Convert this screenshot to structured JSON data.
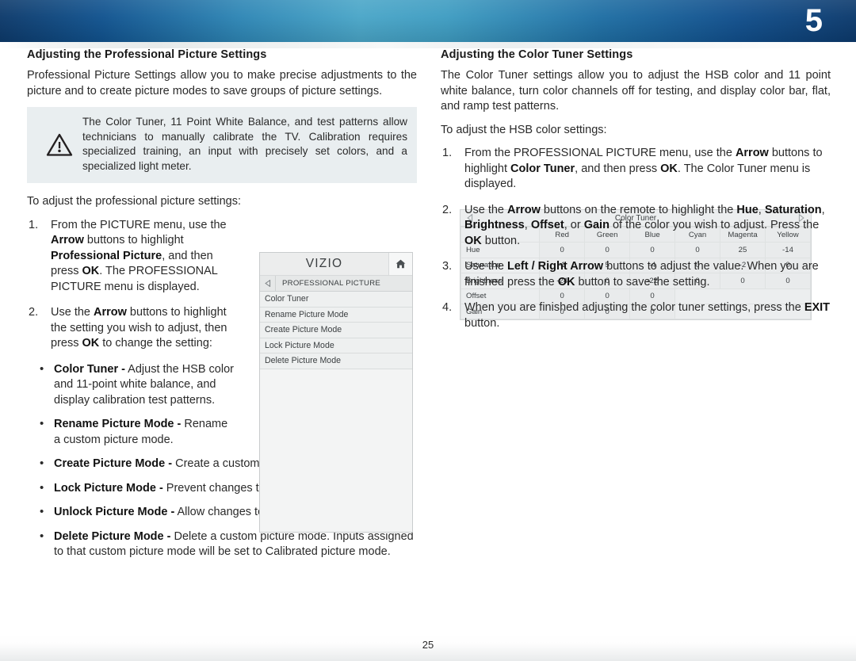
{
  "banner": {
    "chapter_number": "5"
  },
  "left_column": {
    "title": "Adjusting the Professional Picture Settings",
    "intro": "Professional Picture Settings allow you to make precise adjustments to the picture and to create picture modes to save groups of picture settings.",
    "note": {
      "icon": "warning-triangle-icon",
      "text": "The Color Tuner, 11 Point White Balance, and test patterns allow technicians to manually calibrate the TV. Calibration requires specialized training, an input with precisely set colors, and a specialized light meter."
    },
    "lead_in": "To adjust the professional picture settings:",
    "steps": [
      {
        "num": "1.",
        "parts": [
          {
            "t": "From the PICTURE menu, use the ",
            "b": false
          },
          {
            "t": "Arrow",
            "b": true
          },
          {
            "t": " buttons to highlight ",
            "b": false
          },
          {
            "t": "Professional Picture",
            "b": true
          },
          {
            "t": ", and then press ",
            "b": false
          },
          {
            "t": "OK",
            "b": true
          },
          {
            "t": ". The PROFESSIONAL PICTURE menu is displayed.",
            "b": false
          }
        ]
      },
      {
        "num": "2.",
        "parts": [
          {
            "t": "Use the ",
            "b": false
          },
          {
            "t": "Arrow",
            "b": true
          },
          {
            "t": " buttons to highlight the setting you wish to adjust, then press ",
            "b": false
          },
          {
            "t": "OK",
            "b": true
          },
          {
            "t": " to change the setting:",
            "b": false
          }
        ]
      }
    ],
    "bullets_narrow": [
      {
        "parts": [
          {
            "t": "Color Tuner -",
            "b": true
          },
          {
            "t": " Adjust the HSB color and 11-point white balance, and display calibration test patterns.",
            "b": false
          }
        ]
      },
      {
        "parts": [
          {
            "t": "Rename Picture Mode -",
            "b": true
          },
          {
            "t": " Rename a custom picture mode.",
            "b": false
          }
        ]
      }
    ],
    "bullets_wide": [
      {
        "parts": [
          {
            "t": "Create Picture Mode -",
            "b": true
          },
          {
            "t": " Create a custom picture mode.",
            "b": false
          }
        ]
      },
      {
        "parts": [
          {
            "t": "Lock Picture Mode -",
            "b": true
          },
          {
            "t": " Prevent changes to picture modes.",
            "b": false
          }
        ]
      },
      {
        "parts": [
          {
            "t": "Unlock Picture Mode -",
            "b": true
          },
          {
            "t": " Allow changes to picture modes.",
            "b": false
          }
        ]
      },
      {
        "parts": [
          {
            "t": "Delete Picture Mode -",
            "b": true
          },
          {
            "t": " Delete a custom picture mode. Inputs assigned to that custom picture mode will be set to Calibrated picture mode.",
            "b": false
          }
        ]
      }
    ],
    "vizio_menu": {
      "logo": "VIZIO",
      "home_icon": "home-icon",
      "back_icon": "back-triangle-icon",
      "breadcrumb": "PROFESSIONAL PICTURE",
      "items": [
        "Color Tuner",
        "Rename Picture Mode",
        "Create Picture Mode",
        "Lock Picture Mode",
        "Delete Picture Mode"
      ]
    }
  },
  "right_column": {
    "title": "Adjusting the Color Tuner Settings",
    "intro": "The Color Tuner settings allow you to adjust the HSB color and 11 point white balance, turn color channels off for testing, and display color bar, flat, and ramp test patterns.",
    "lead_in": "To adjust the HSB color settings:",
    "steps": [
      {
        "num": "1.",
        "parts": [
          {
            "t": "From the PROFESSIONAL PICTURE menu, use the ",
            "b": false
          },
          {
            "t": "Arrow",
            "b": true
          },
          {
            "t": " buttons to highlight ",
            "b": false
          },
          {
            "t": "Color Tuner",
            "b": true
          },
          {
            "t": ", and then press ",
            "b": false
          },
          {
            "t": "OK",
            "b": true
          },
          {
            "t": ". The Color Tuner menu is displayed.",
            "b": false
          }
        ]
      },
      {
        "num": "2.",
        "parts": [
          {
            "t": "Use the ",
            "b": false
          },
          {
            "t": "Arrow",
            "b": true
          },
          {
            "t": " buttons on the remote to highlight the ",
            "b": false
          },
          {
            "t": "Hue",
            "b": true
          },
          {
            "t": ", ",
            "b": false
          },
          {
            "t": "Saturation",
            "b": true
          },
          {
            "t": ", ",
            "b": false
          },
          {
            "t": "Brightness",
            "b": true
          },
          {
            "t": ", ",
            "b": false
          },
          {
            "t": "Offset",
            "b": true
          },
          {
            "t": ", or ",
            "b": false
          },
          {
            "t": "Gain",
            "b": true
          },
          {
            "t": " of the color you wish to adjust. Press the ",
            "b": false
          },
          {
            "t": "OK",
            "b": true
          },
          {
            "t": "  button.",
            "b": false
          }
        ]
      },
      {
        "num": "3.",
        "parts": [
          {
            "t": "Use the ",
            "b": false
          },
          {
            "t": "Left / Right Arrow",
            "b": true
          },
          {
            "t": " buttons to adjust the value. When you are finished press the ",
            "b": false
          },
          {
            "t": "OK",
            "b": true
          },
          {
            "t": " button to save the setting.",
            "b": false
          }
        ]
      },
      {
        "num": "4.",
        "parts": [
          {
            "t": "When you are finished adjusting the color tuner settings, press the ",
            "b": false
          },
          {
            "t": "EXIT",
            "b": true
          },
          {
            "t": " button.",
            "b": false
          }
        ]
      }
    ],
    "color_tuner": {
      "title": "Color Tuner",
      "left_arrow_icon": "left-triangle-icon",
      "right_arrow_icon": "right-triangle-icon",
      "columns": [
        "Red",
        "Green",
        "Blue",
        "Cyan",
        "Magenta",
        "Yellow"
      ],
      "rows": [
        {
          "label": "Hue",
          "values": [
            "0",
            "0",
            "0",
            "0",
            "25",
            "-14"
          ]
        },
        {
          "label": "Saturation",
          "values": [
            "-1",
            "5",
            "-4",
            "0",
            "-2",
            "0"
          ]
        },
        {
          "label": "Brightness",
          "values": [
            "-24",
            "0",
            "-22",
            "0",
            "0",
            "0"
          ]
        },
        {
          "label": "Offset",
          "values": [
            "0",
            "0",
            "0",
            "",
            "",
            ""
          ]
        },
        {
          "label": "Gain",
          "values": [
            "0",
            "0",
            "0",
            "",
            "",
            ""
          ]
        }
      ]
    }
  },
  "footer": {
    "page_number": "25"
  }
}
